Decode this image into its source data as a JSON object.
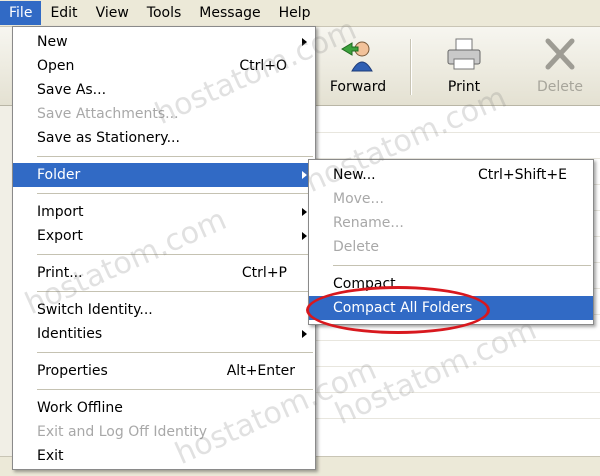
{
  "menubar": {
    "items": [
      "File",
      "Edit",
      "View",
      "Tools",
      "Message",
      "Help"
    ]
  },
  "toolbar": {
    "forward": "Forward",
    "print": "Print",
    "delete": "Delete"
  },
  "file_menu": {
    "new": "New",
    "open": "Open",
    "open_shortcut": "Ctrl+O",
    "save_as": "Save As...",
    "save_attachments": "Save Attachments...",
    "save_as_stationery": "Save as Stationery...",
    "folder": "Folder",
    "import": "Import",
    "export": "Export",
    "print": "Print...",
    "print_shortcut": "Ctrl+P",
    "switch_identity": "Switch Identity...",
    "identities": "Identities",
    "properties": "Properties",
    "properties_shortcut": "Alt+Enter",
    "work_offline": "Work Offline",
    "exit_logoff": "Exit and Log Off Identity",
    "exit": "Exit"
  },
  "folder_menu": {
    "new": "New...",
    "new_shortcut": "Ctrl+Shift+E",
    "move": "Move...",
    "rename": "Rename...",
    "delete": "Delete",
    "compact": "Compact",
    "compact_all": "Compact All Folders"
  },
  "watermark": "hostatom.com",
  "colors": {
    "highlight": "#316ac5",
    "ellipse": "#d8181e"
  }
}
